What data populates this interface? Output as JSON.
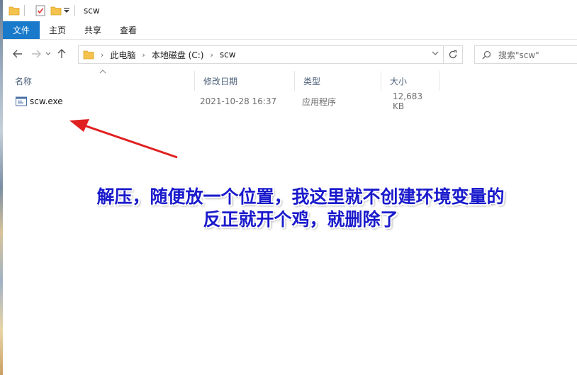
{
  "window": {
    "title": "scw"
  },
  "ribbon": {
    "tabs": [
      "文件",
      "主页",
      "共享",
      "查看"
    ]
  },
  "nav": {
    "breadcrumb": [
      "此电脑",
      "本地磁盘 (C:)",
      "scw"
    ],
    "search_placeholder": "搜索\"scw\""
  },
  "columns": {
    "name": "名称",
    "modified": "修改日期",
    "type": "类型",
    "size": "大小"
  },
  "files": [
    {
      "name": "scw.exe",
      "modified": "2021-10-28 16:37",
      "type": "应用程序",
      "size": "12,683 KB"
    }
  ],
  "annotation": {
    "line1": "解压，随便放一个位置，我这里就不创建环境变量的",
    "line2": "反正就开个鸡，就删除了",
    "color": "#1a1acc",
    "arrow_color": "#e02020"
  },
  "colors": {
    "file_tab_bg": "#1979ca",
    "header_text": "#4c607a",
    "folder_yellow": "#f5c34d"
  }
}
